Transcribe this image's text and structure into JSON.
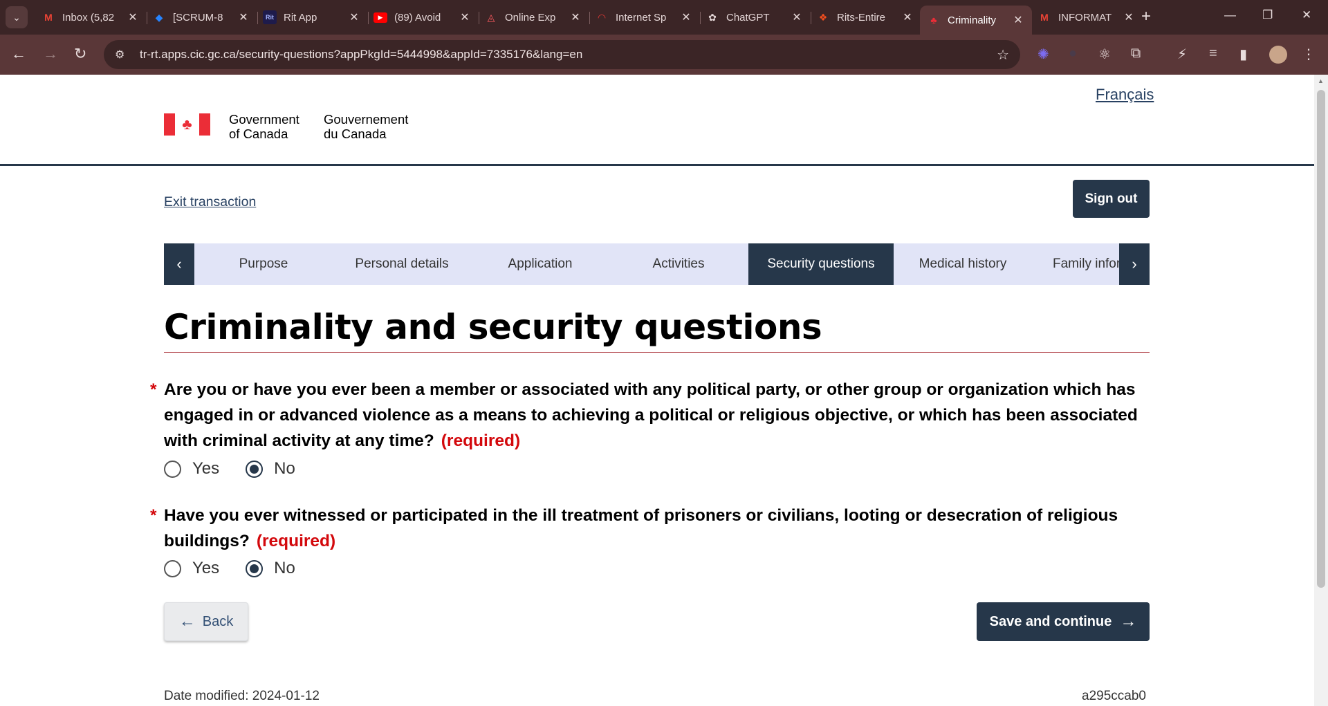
{
  "browser": {
    "tabs": [
      {
        "title": "Inbox (5,82",
        "icon": "gmail-icon"
      },
      {
        "title": "[SCRUM-8",
        "icon": "jira-icon"
      },
      {
        "title": "Rit App",
        "icon": "rit-icon"
      },
      {
        "title": "(89) Avoid",
        "icon": "youtube-icon"
      },
      {
        "title": "Online Exp",
        "icon": "airbnb-icon"
      },
      {
        "title": "Internet Sp",
        "icon": "speedtest-icon"
      },
      {
        "title": "ChatGPT",
        "icon": "chatgpt-icon"
      },
      {
        "title": "Rits-Entire",
        "icon": "figma-icon"
      },
      {
        "title": "Criminality",
        "icon": "canada-maple-icon"
      },
      {
        "title": "INFORMAT",
        "icon": "gmail-icon"
      }
    ],
    "url": "tr-rt.apps.cic.gc.ca/security-questions?appPkgId=5444998&appId=7335176&lang=en"
  },
  "header": {
    "language_link": "Français",
    "gov_en_line1": "Government",
    "gov_en_line2": "of Canada",
    "gov_fr_line1": "Gouvernement",
    "gov_fr_line2": "du Canada"
  },
  "actions": {
    "exit": "Exit transaction",
    "sign_out": "Sign out"
  },
  "steps": [
    {
      "label": "Purpose"
    },
    {
      "label": "Personal details"
    },
    {
      "label": "Application"
    },
    {
      "label": "Activities"
    },
    {
      "label": "Security questions",
      "current": true
    },
    {
      "label": "Medical history"
    },
    {
      "label": "Family infor"
    }
  ],
  "page_title": "Criminality and security questions",
  "questions": [
    {
      "text": "Are you or have you ever been a member or associated with any political party, or other group or organization which has engaged in or advanced violence as a means to achieving a political or religious objective, or which has been associated with criminal activity at any time?",
      "required_label": "(required)",
      "options": [
        "Yes",
        "No"
      ],
      "selected": "No"
    },
    {
      "text": "Have you ever witnessed or participated in the ill treatment of prisoners or civilians, looting or desecration of religious buildings?",
      "required_label": "(required)",
      "options": [
        "Yes",
        "No"
      ],
      "selected": "No"
    }
  ],
  "buttons": {
    "back": "Back",
    "save": "Save and continue"
  },
  "footer": {
    "date_modified": "Date modified: 2024-01-12",
    "version": "a295ccab0"
  },
  "colors": {
    "primary": "#26374a",
    "link": "#284162",
    "required": "#d3080c",
    "step_bg": "#e1e4f7",
    "title_rule": "#af3c43"
  }
}
